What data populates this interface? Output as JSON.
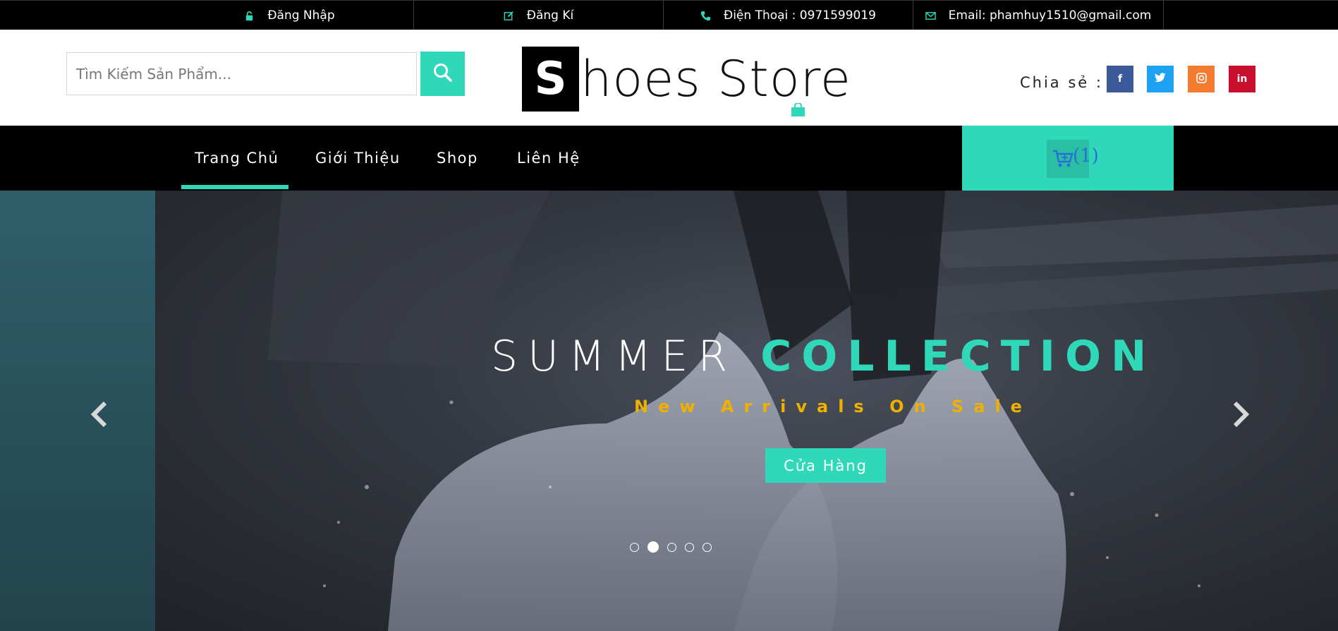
{
  "topbar": {
    "login": "Đăng Nhập",
    "register": "Đăng Kí",
    "phone": "Điện Thoại : 0971599019",
    "email": "Email: phamhuy1510@gmail.com"
  },
  "header": {
    "search_placeholder": "Tìm Kiếm Sản Phẩm...",
    "logo_letter": "S",
    "logo_rest": "hoes Store",
    "share_label": "Chia sẻ :",
    "social": [
      {
        "name": "facebook",
        "glyph": "f",
        "color": "#3b5998"
      },
      {
        "name": "twitter",
        "glyph": "t",
        "color": "#1da1f2"
      },
      {
        "name": "instagram",
        "glyph": "◎",
        "color": "#f47c30"
      },
      {
        "name": "linkedin",
        "glyph": "in",
        "color": "#c8102e"
      }
    ]
  },
  "nav": {
    "items": [
      "Trang Chủ",
      "Giới Thiệu",
      "Shop",
      "Liên Hệ"
    ],
    "active_index": 0,
    "cart_count": "(1)"
  },
  "hero": {
    "title_plain": "SUMMER",
    "title_accent": "COLLECTION",
    "subtitle": "New Arrivals On Sale",
    "button": "Cửa Hàng",
    "slide_count": 5,
    "active_slide": 1
  },
  "colors": {
    "accent": "#2fd8b8",
    "subtitle": "#f0b000",
    "topbar_bg": "#000000"
  },
  "icons": [
    "lock-icon",
    "edit-icon",
    "phone-icon",
    "envelope-icon",
    "search-icon",
    "shopping-bag-icon",
    "cart-icon",
    "chevron-left-icon",
    "chevron-right-icon"
  ]
}
